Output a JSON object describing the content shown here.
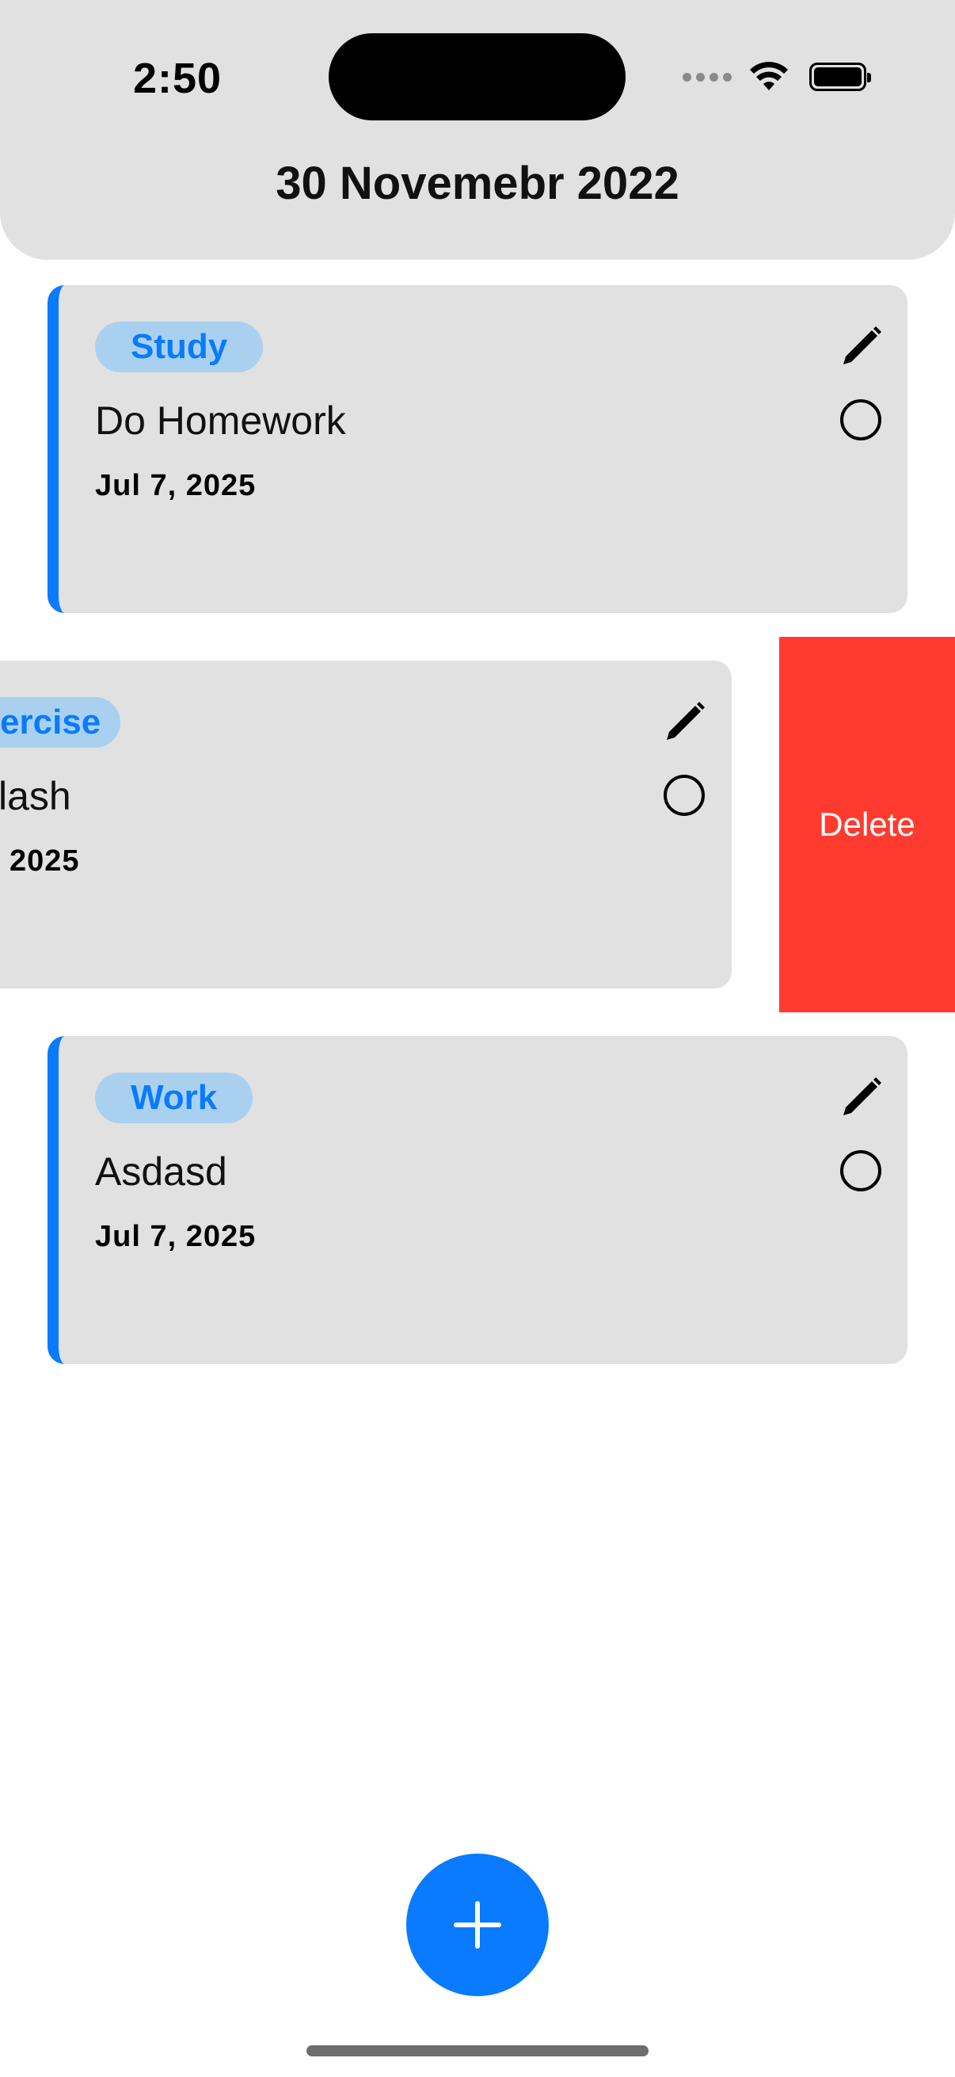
{
  "status_bar": {
    "time": "2:50"
  },
  "header": {
    "title": "30 Novemebr 2022"
  },
  "tasks": [
    {
      "category": "Study",
      "title": "Do Homework",
      "date": "Jul 7, 2025"
    },
    {
      "category": "ercise",
      "title": "lash",
      "date": "2025"
    },
    {
      "category": "Work",
      "title": "Asdasd",
      "date": "Jul 7, 2025"
    }
  ],
  "swipe_action": {
    "delete_label": "Delete"
  },
  "colors": {
    "accent": "#0a7aff",
    "tag_bg": "#a9d1ef",
    "card_bg": "#e1e1e1",
    "delete": "#ff3b30"
  },
  "icons": {
    "edit": "pencil-icon",
    "complete": "circle-icon",
    "add": "plus-icon"
  }
}
